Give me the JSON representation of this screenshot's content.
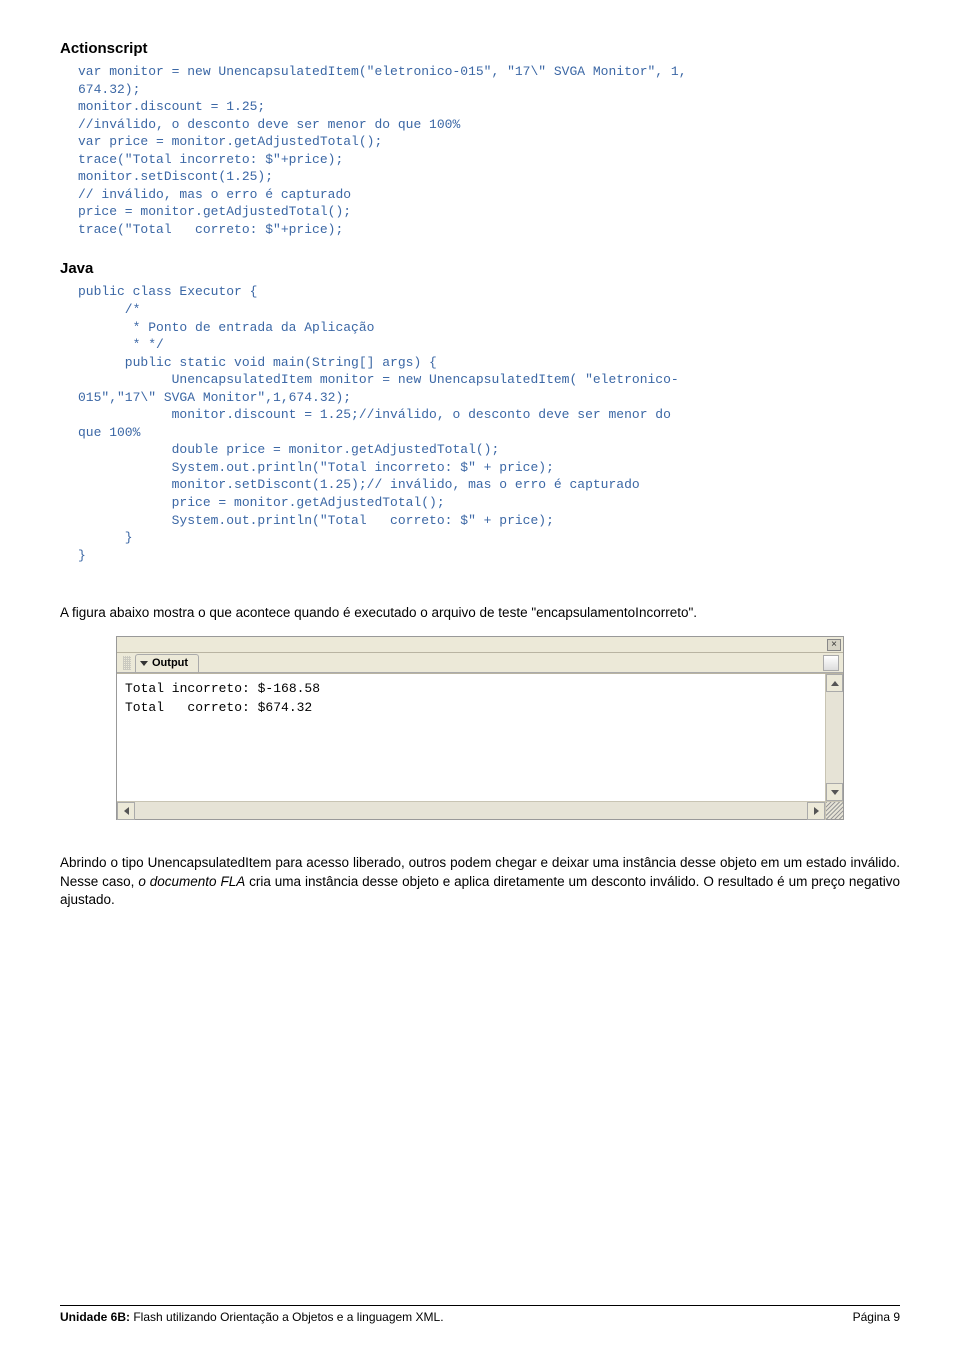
{
  "section1": {
    "title": "Actionscript",
    "code": "var monitor = new UnencapsulatedItem(\"eletronico-015\", \"17\\\" SVGA Monitor\", 1,\n674.32);\nmonitor.discount = 1.25;\n//inválido, o desconto deve ser menor do que 100%\nvar price = monitor.getAdjustedTotal();\ntrace(\"Total incorreto: $\"+price);\nmonitor.setDiscont(1.25);\n// inválido, mas o erro é capturado\nprice = monitor.getAdjustedTotal();\ntrace(\"Total   correto: $\"+price);"
  },
  "section2": {
    "title": "Java",
    "code": "public class Executor {\n      /*\n       * Ponto de entrada da Aplicação\n       * */\n      public static void main(String[] args) {\n            UnencapsulatedItem monitor = new UnencapsulatedItem( \"eletronico-\n015\",\"17\\\" SVGA Monitor\",1,674.32);\n            monitor.discount = 1.25;//inválido, o desconto deve ser menor do\nque 100%\n            double price = monitor.getAdjustedTotal();\n            System.out.println(\"Total incorreto: $\" + price);\n            monitor.setDiscont(1.25);// inválido, mas o erro é capturado\n            price = monitor.getAdjustedTotal();\n            System.out.println(\"Total   correto: $\" + price);\n      }\n}"
  },
  "para1": "A figura abaixo mostra o que acontece quando é executado o arquivo de teste \"encapsulamentoIncorreto\".",
  "output": {
    "tab": "Output",
    "text": "Total incorreto: $-168.58\nTotal   correto: $674.32"
  },
  "para2_plain": "Abrindo o tipo UnencapsulatedItem para acesso liberado, outros podem chegar e deixar uma instância desse objeto em um estado inválido. Nesse caso, ",
  "para2_italic": "o documento FLA",
  "para2_tail": " cria uma instância desse objeto e aplica diretamente um desconto inválido. O resultado é um preço negativo ajustado.",
  "footer": {
    "left_bold": "Unidade 6B:",
    "left_rest": " Flash utilizando Orientação a Objetos e a linguagem XML.",
    "right": "Página 9"
  }
}
